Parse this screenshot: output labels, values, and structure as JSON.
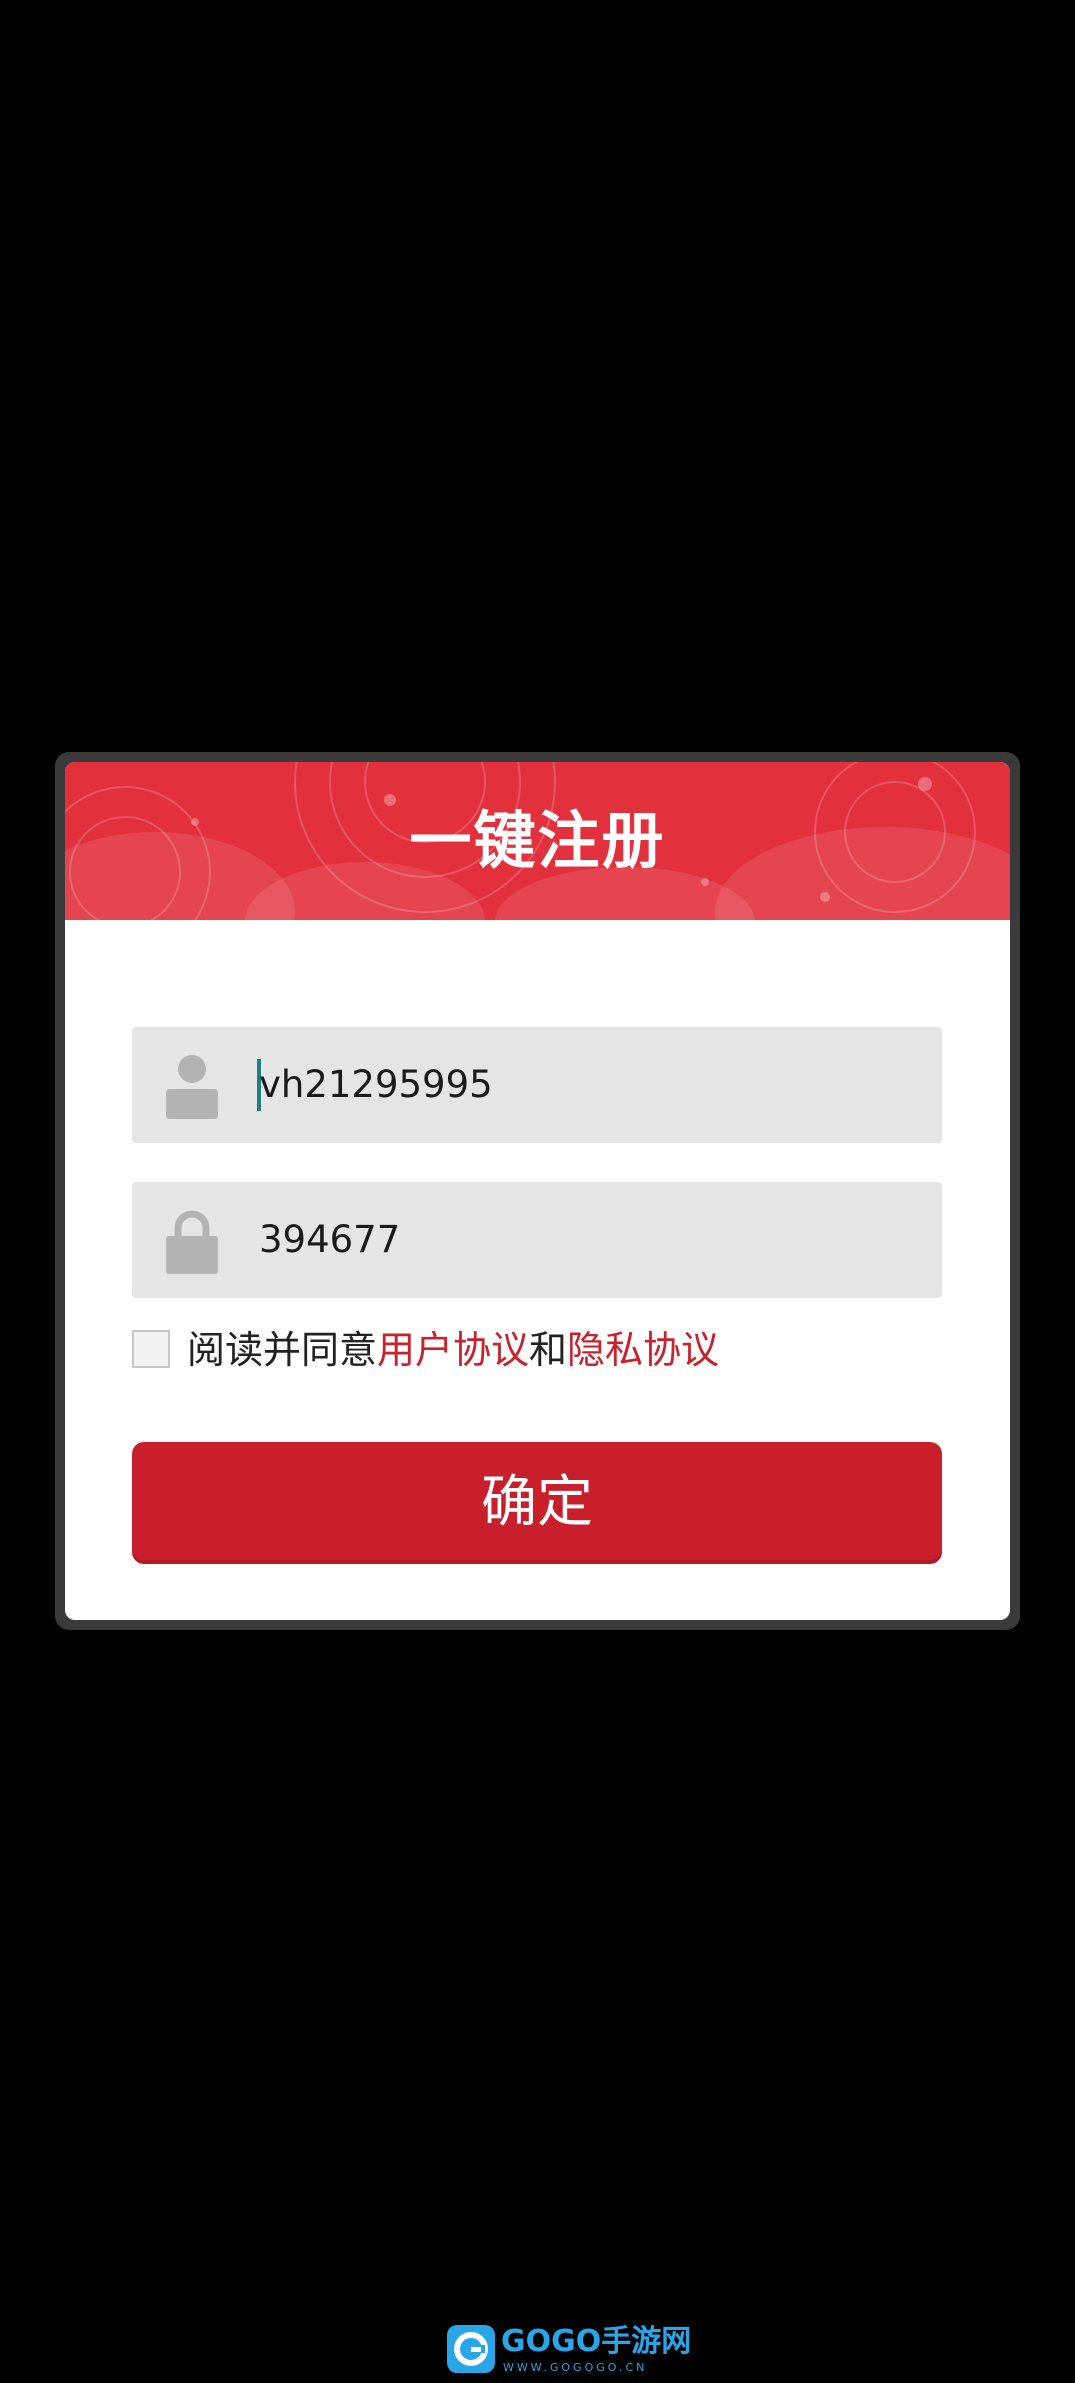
{
  "dialog": {
    "title": "一键注册",
    "username": {
      "value": "vh21295995",
      "icon": "user-icon"
    },
    "password": {
      "value": "394677",
      "icon": "lock-icon"
    },
    "agreement": {
      "checked": false,
      "prefix": "阅读并同意",
      "user_agreement_link": "用户协议",
      "conjunction": "和",
      "privacy_link": "隐私协议"
    },
    "confirm_label": "确定"
  },
  "watermark": {
    "brand": "GOGO手游网",
    "url": "WWW.GOGOGO.CN"
  },
  "colors": {
    "header_red": "#e2303d",
    "button_red": "#c91f2c",
    "link_red": "#c8222d",
    "input_bg": "#e5e5e5",
    "background": "#000000"
  }
}
